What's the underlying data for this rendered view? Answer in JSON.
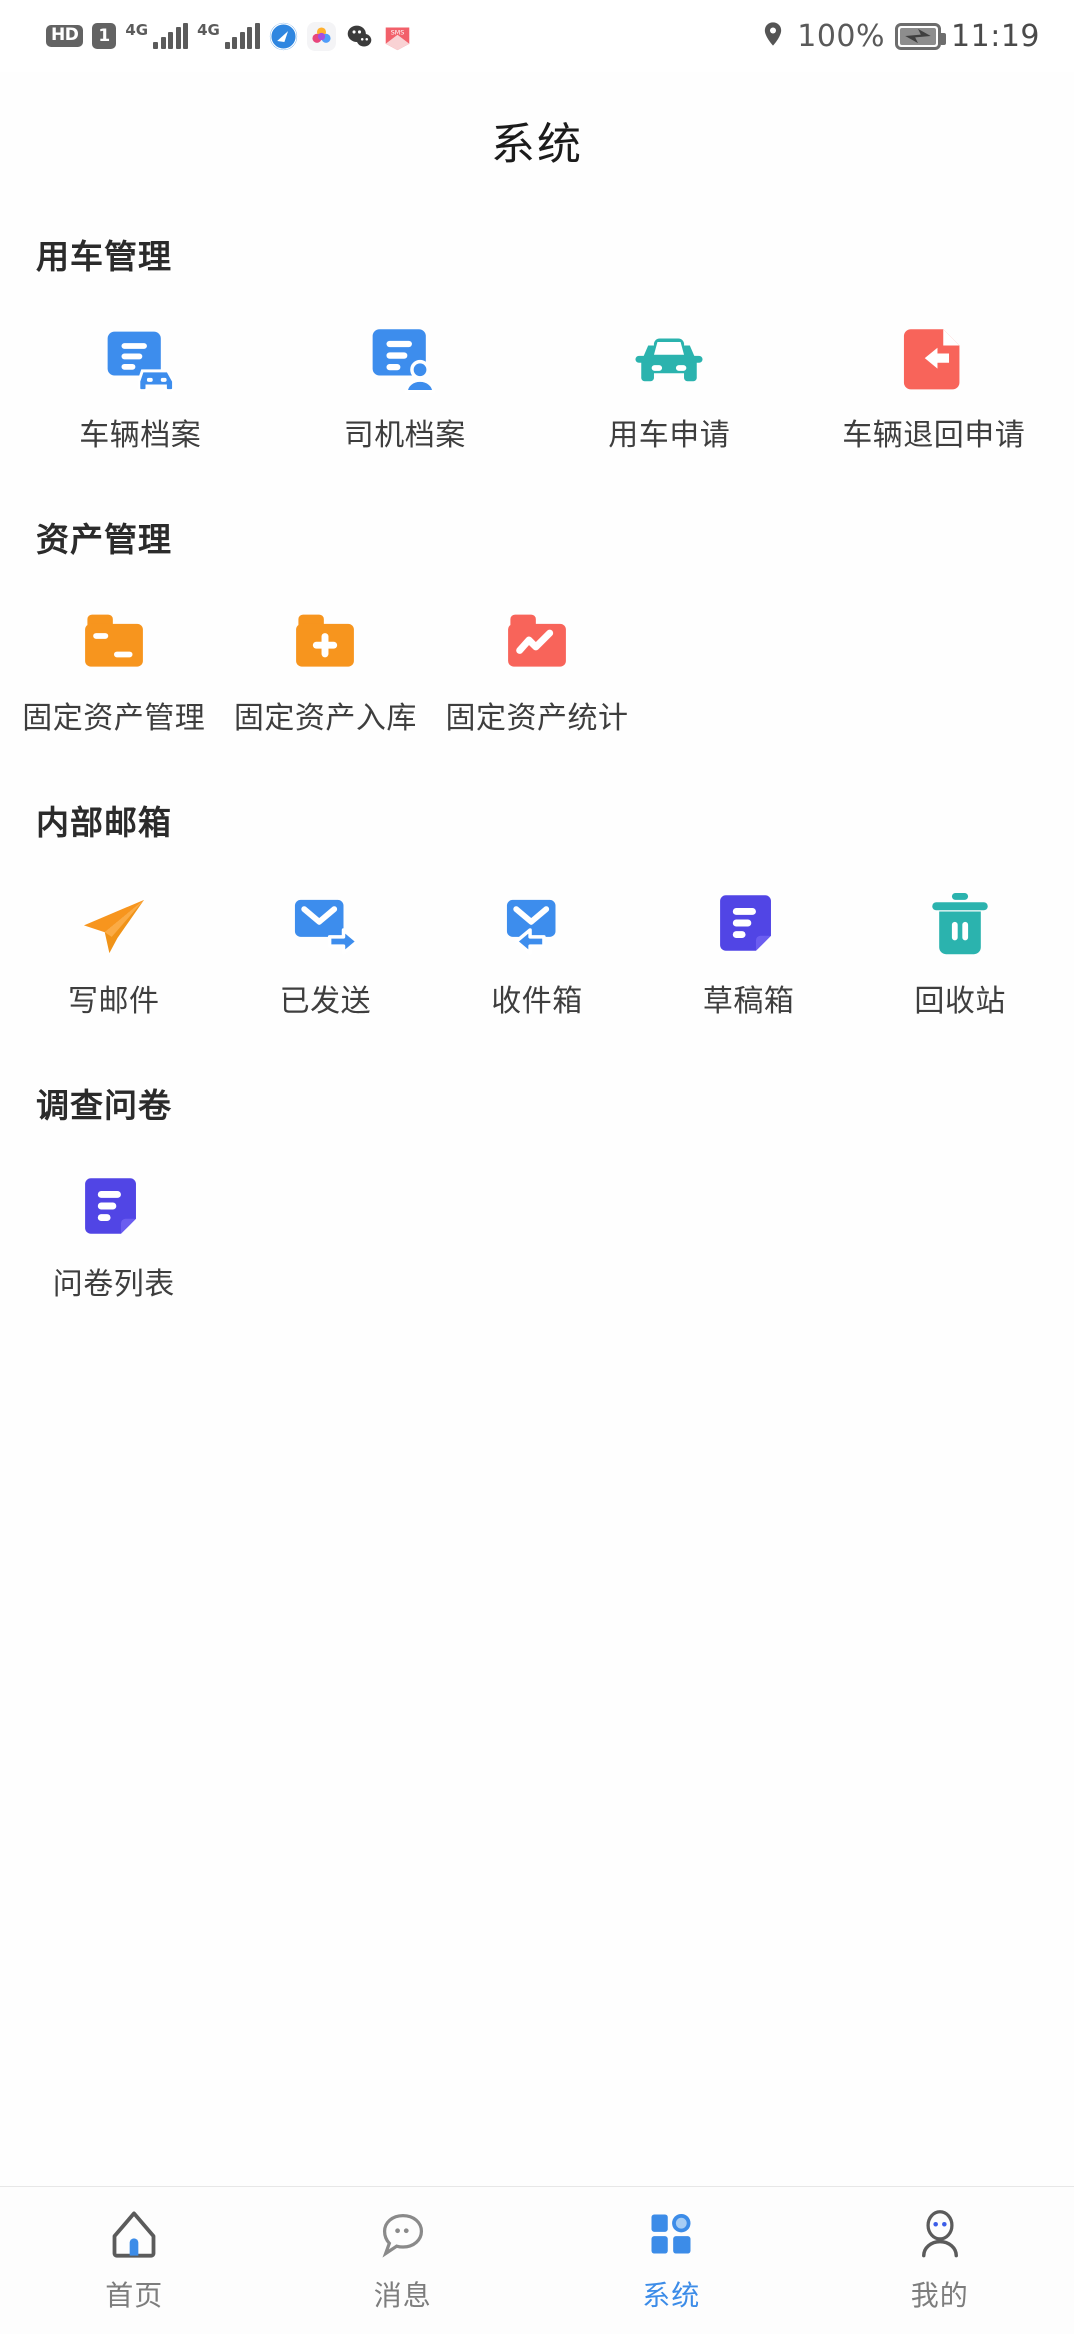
{
  "status_bar": {
    "hd_badge": "HD",
    "sim_badge": "1",
    "network_1": "4G",
    "network_2": "4G",
    "app_icons": [
      "browser-icon",
      "photos-icon",
      "wechat-icon",
      "mail-card-icon"
    ],
    "location_icon": "location-pin-icon",
    "battery_percent": "100%",
    "battery_icon": "battery-charging-icon",
    "time": "11:19"
  },
  "header": {
    "title": "系统"
  },
  "sections": [
    {
      "title": "用车管理",
      "columns": 4,
      "items": [
        {
          "label": "车辆档案",
          "icon": "vehicle-file-icon",
          "color": "#3d8ded"
        },
        {
          "label": "司机档案",
          "icon": "driver-file-icon",
          "color": "#3d8ded"
        },
        {
          "label": "用车申请",
          "icon": "car-icon",
          "color": "#2bb3ae"
        },
        {
          "label": "车辆退回申请",
          "icon": "vehicle-return-icon",
          "color": "#f8645a"
        }
      ]
    },
    {
      "title": "资产管理",
      "columns": 5,
      "items": [
        {
          "label": "固定资产管理",
          "icon": "folder-asset-icon",
          "color": "#f7951e"
        },
        {
          "label": "固定资产入库",
          "icon": "folder-add-icon",
          "color": "#f7951e"
        },
        {
          "label": "固定资产统计",
          "icon": "folder-chart-icon",
          "color": "#f8645a"
        }
      ]
    },
    {
      "title": "内部邮箱",
      "columns": 5,
      "items": [
        {
          "label": "写邮件",
          "icon": "paper-plane-icon",
          "color": "#f7951e"
        },
        {
          "label": "已发送",
          "icon": "mail-sent-icon",
          "color": "#3d8ded"
        },
        {
          "label": "收件箱",
          "icon": "mail-inbox-icon",
          "color": "#3d8ded"
        },
        {
          "label": "草稿箱",
          "icon": "draft-document-icon",
          "color": "#5145e5"
        },
        {
          "label": "回收站",
          "icon": "trash-icon",
          "color": "#2bb3ae"
        }
      ]
    },
    {
      "title": "调查问卷",
      "columns": 5,
      "items": [
        {
          "label": "问卷列表",
          "icon": "survey-list-icon",
          "color": "#5145e5"
        }
      ]
    }
  ],
  "tabbar": {
    "active_index": 2,
    "items": [
      {
        "label": "首页",
        "icon": "home-icon"
      },
      {
        "label": "消息",
        "icon": "message-bubble-icon"
      },
      {
        "label": "系统",
        "icon": "grid-squares-icon"
      },
      {
        "label": "我的",
        "icon": "person-icon"
      }
    ]
  },
  "colors": {
    "accent": "#3c8ce8",
    "blue": "#3d8ded",
    "orange": "#f7951e",
    "red": "#f8645a",
    "teal": "#2bb3ae",
    "purple": "#5145e5",
    "label": "#3e3e3e",
    "inactive_tab": "#7d7d7d"
  }
}
